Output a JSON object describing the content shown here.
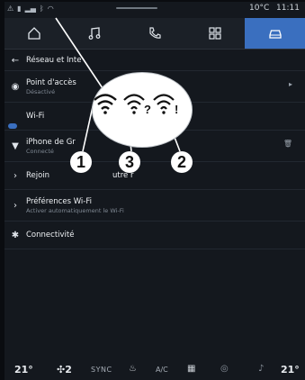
{
  "status_bar": {
    "temperature": "10°C",
    "time": "11:11"
  },
  "top_nav": [
    {
      "name": "home",
      "icon": "home-icon"
    },
    {
      "name": "music",
      "icon": "music-icon"
    },
    {
      "name": "phone",
      "icon": "phone-icon"
    },
    {
      "name": "apps",
      "icon": "apps-grid-icon"
    },
    {
      "name": "car",
      "icon": "car-icon",
      "active": true
    }
  ],
  "settings": {
    "back_title": "Réseau et Inte",
    "items": [
      {
        "label": "Point d'accès",
        "sublabel": "Désactivé"
      },
      {
        "label": "Wi-Fi",
        "sublabel": ""
      },
      {
        "label": "iPhone de Gr",
        "sublabel": "Connecté"
      },
      {
        "label": "Rejoin",
        "sublabel": "",
        "right_text": "utre r"
      },
      {
        "label": "Préférences Wi-Fi",
        "sublabel": "Activer automatiquement le Wi-Fi"
      },
      {
        "label": "Connectivité",
        "sublabel": ""
      }
    ]
  },
  "climate_bar": {
    "temp_left": "21°",
    "fan_level": "2",
    "sync_label": "SYNC",
    "ac_label": "A/C",
    "temp_right": "21°"
  },
  "callouts": {
    "c1": "1",
    "c2": "2",
    "c3": "3"
  },
  "zoom_symbols": {
    "unknown": "?",
    "warning": "!"
  },
  "colors": {
    "accent": "#3a6fbf",
    "background": "#14181e"
  }
}
